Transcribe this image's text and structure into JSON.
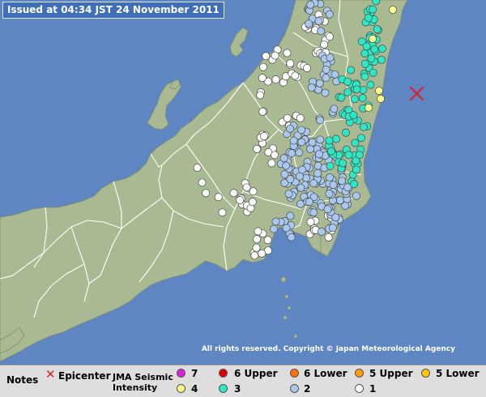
{
  "header": {
    "issued": "Issued at 04:34 JST  24 November 2011"
  },
  "copyright": "All rights reserved. Copyright © Japan Meteorological Agency",
  "legend": {
    "notes_label": "Notes",
    "epicenter_label": "Epicenter",
    "intensity_label_1": "JMA Seismic",
    "intensity_label_2": "Intensity",
    "levels": [
      {
        "label": "7",
        "color": "#e01ee0"
      },
      {
        "label": "6 Upper",
        "color": "#e00000"
      },
      {
        "label": "6 Lower",
        "color": "#ff7000"
      },
      {
        "label": "5 Upper",
        "color": "#ff9e00"
      },
      {
        "label": "5 Lower",
        "color": "#ffc800"
      },
      {
        "label": "4",
        "color": "#ffff8c"
      },
      {
        "label": "3",
        "color": "#2ce8c4"
      },
      {
        "label": "2",
        "color": "#a8c8ee"
      },
      {
        "label": "1",
        "color": "#ffffff"
      }
    ]
  },
  "colors": {
    "sea": "#5e86c2",
    "land": "#a9b991",
    "prefecture_border": "#ffffff",
    "epicenter": "#d6232a"
  },
  "icons": {
    "epicenter": "cross-icon",
    "station": "circle-marker"
  }
}
